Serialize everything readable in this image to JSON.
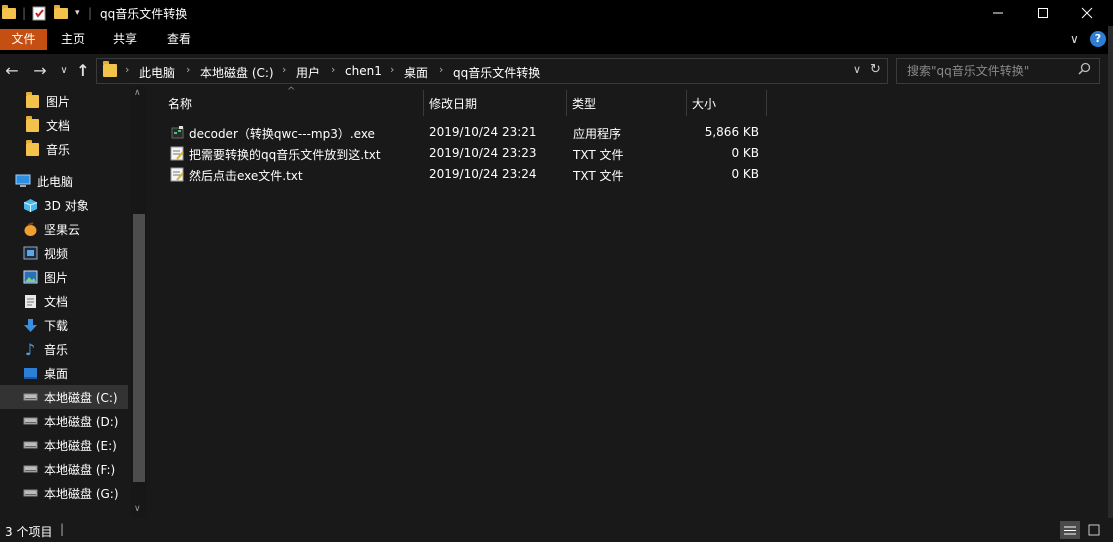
{
  "window": {
    "title": "qq音乐文件转换"
  },
  "ribbon": {
    "tabs": [
      "文件",
      "主页",
      "共享",
      "查看"
    ]
  },
  "address": {
    "crumbs": [
      "此电脑",
      "本地磁盘 (C:)",
      "用户",
      "chen1",
      "桌面",
      "qq音乐文件转换"
    ],
    "search_placeholder": "搜索\"qq音乐文件转换\""
  },
  "nav": {
    "items": [
      {
        "label": "图片",
        "icon": "folder-icon"
      },
      {
        "label": "文档",
        "icon": "folder-icon"
      },
      {
        "label": "音乐",
        "icon": "folder-icon"
      },
      {
        "label": "此电脑",
        "icon": "computer-icon"
      },
      {
        "label": "3D 对象",
        "icon": "3d-objects-icon"
      },
      {
        "label": "坚果云",
        "icon": "nutstore-icon"
      },
      {
        "label": "视频",
        "icon": "video-icon"
      },
      {
        "label": "图片",
        "icon": "pictures-icon"
      },
      {
        "label": "文档",
        "icon": "documents-icon"
      },
      {
        "label": "下载",
        "icon": "download-icon"
      },
      {
        "label": "音乐",
        "icon": "music-icon"
      },
      {
        "label": "桌面",
        "icon": "desktop-icon"
      },
      {
        "label": "本地磁盘 (C:)",
        "icon": "drive-icon"
      },
      {
        "label": "本地磁盘 (D:)",
        "icon": "drive-icon"
      },
      {
        "label": "本地磁盘 (E:)",
        "icon": "drive-icon"
      },
      {
        "label": "本地磁盘 (F:)",
        "icon": "drive-icon"
      },
      {
        "label": "本地磁盘 (G:)",
        "icon": "drive-icon"
      }
    ]
  },
  "columns": [
    "名称",
    "修改日期",
    "类型",
    "大小"
  ],
  "files": [
    {
      "name": "decoder（转换qwc---mp3）.exe",
      "date": "2019/10/24 23:21",
      "type": "应用程序",
      "size": "5,866 KB"
    },
    {
      "name": "把需要转换的qq音乐文件放到这.txt",
      "date": "2019/10/24 23:23",
      "type": "TXT 文件",
      "size": "0 KB"
    },
    {
      "name": "然后点击exe文件.txt",
      "date": "2019/10/24 23:24",
      "type": "TXT 文件",
      "size": "0 KB"
    }
  ],
  "status": {
    "count": "3 个项目"
  },
  "colors": {
    "accent": "#c54f13",
    "folder": "#f3c24b",
    "selected": "#333333"
  }
}
